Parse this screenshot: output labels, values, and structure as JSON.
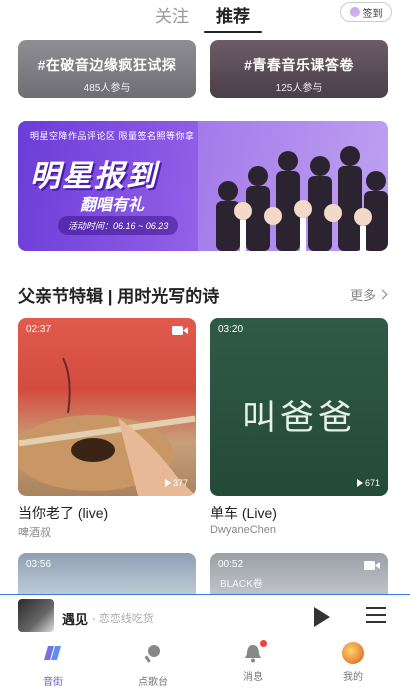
{
  "top_tabs": {
    "follow": "关注",
    "recommend": "推荐",
    "signin": "签到"
  },
  "topics": [
    {
      "title": "#在破音边缘疯狂试探",
      "count": "485人参与"
    },
    {
      "title": "#青春音乐课答卷",
      "count": "125人参与"
    }
  ],
  "banner": {
    "subtitle": "明星空降作品评论区  限量签名照等你拿",
    "headline": "明星报到",
    "slogan": "翻唱有礼",
    "period": "活动时间：06.16 ~ 06.23"
  },
  "section": {
    "title": "父亲节特辑 | 用时光写的诗",
    "more": "更多"
  },
  "videos": [
    {
      "duration": "02:37",
      "plays": "377",
      "title": "当你老了 (live)",
      "author": "啤酒叔"
    },
    {
      "duration": "03:20",
      "plays": "671",
      "title": "单车 (Live)",
      "author": "DwyaneChen",
      "overlay_text": "叫爸爸"
    },
    {
      "duration": "03:56"
    },
    {
      "duration": "00:52",
      "overlay_text": "BLACK卷"
    }
  ],
  "player": {
    "song": "遇见",
    "artist": "- 恋恋线吃货"
  },
  "nav": [
    {
      "label": "音街",
      "icon": "music-street-icon",
      "active": true
    },
    {
      "label": "点歌台",
      "icon": "microphone-icon",
      "active": false
    },
    {
      "label": "消息",
      "icon": "bell-icon",
      "active": false
    },
    {
      "label": "我的",
      "icon": "avatar-icon",
      "active": false
    }
  ],
  "colors": {
    "accent": "#6a5acd",
    "banner_purple": "#7a4ae0",
    "badge_red": "#f04040"
  }
}
